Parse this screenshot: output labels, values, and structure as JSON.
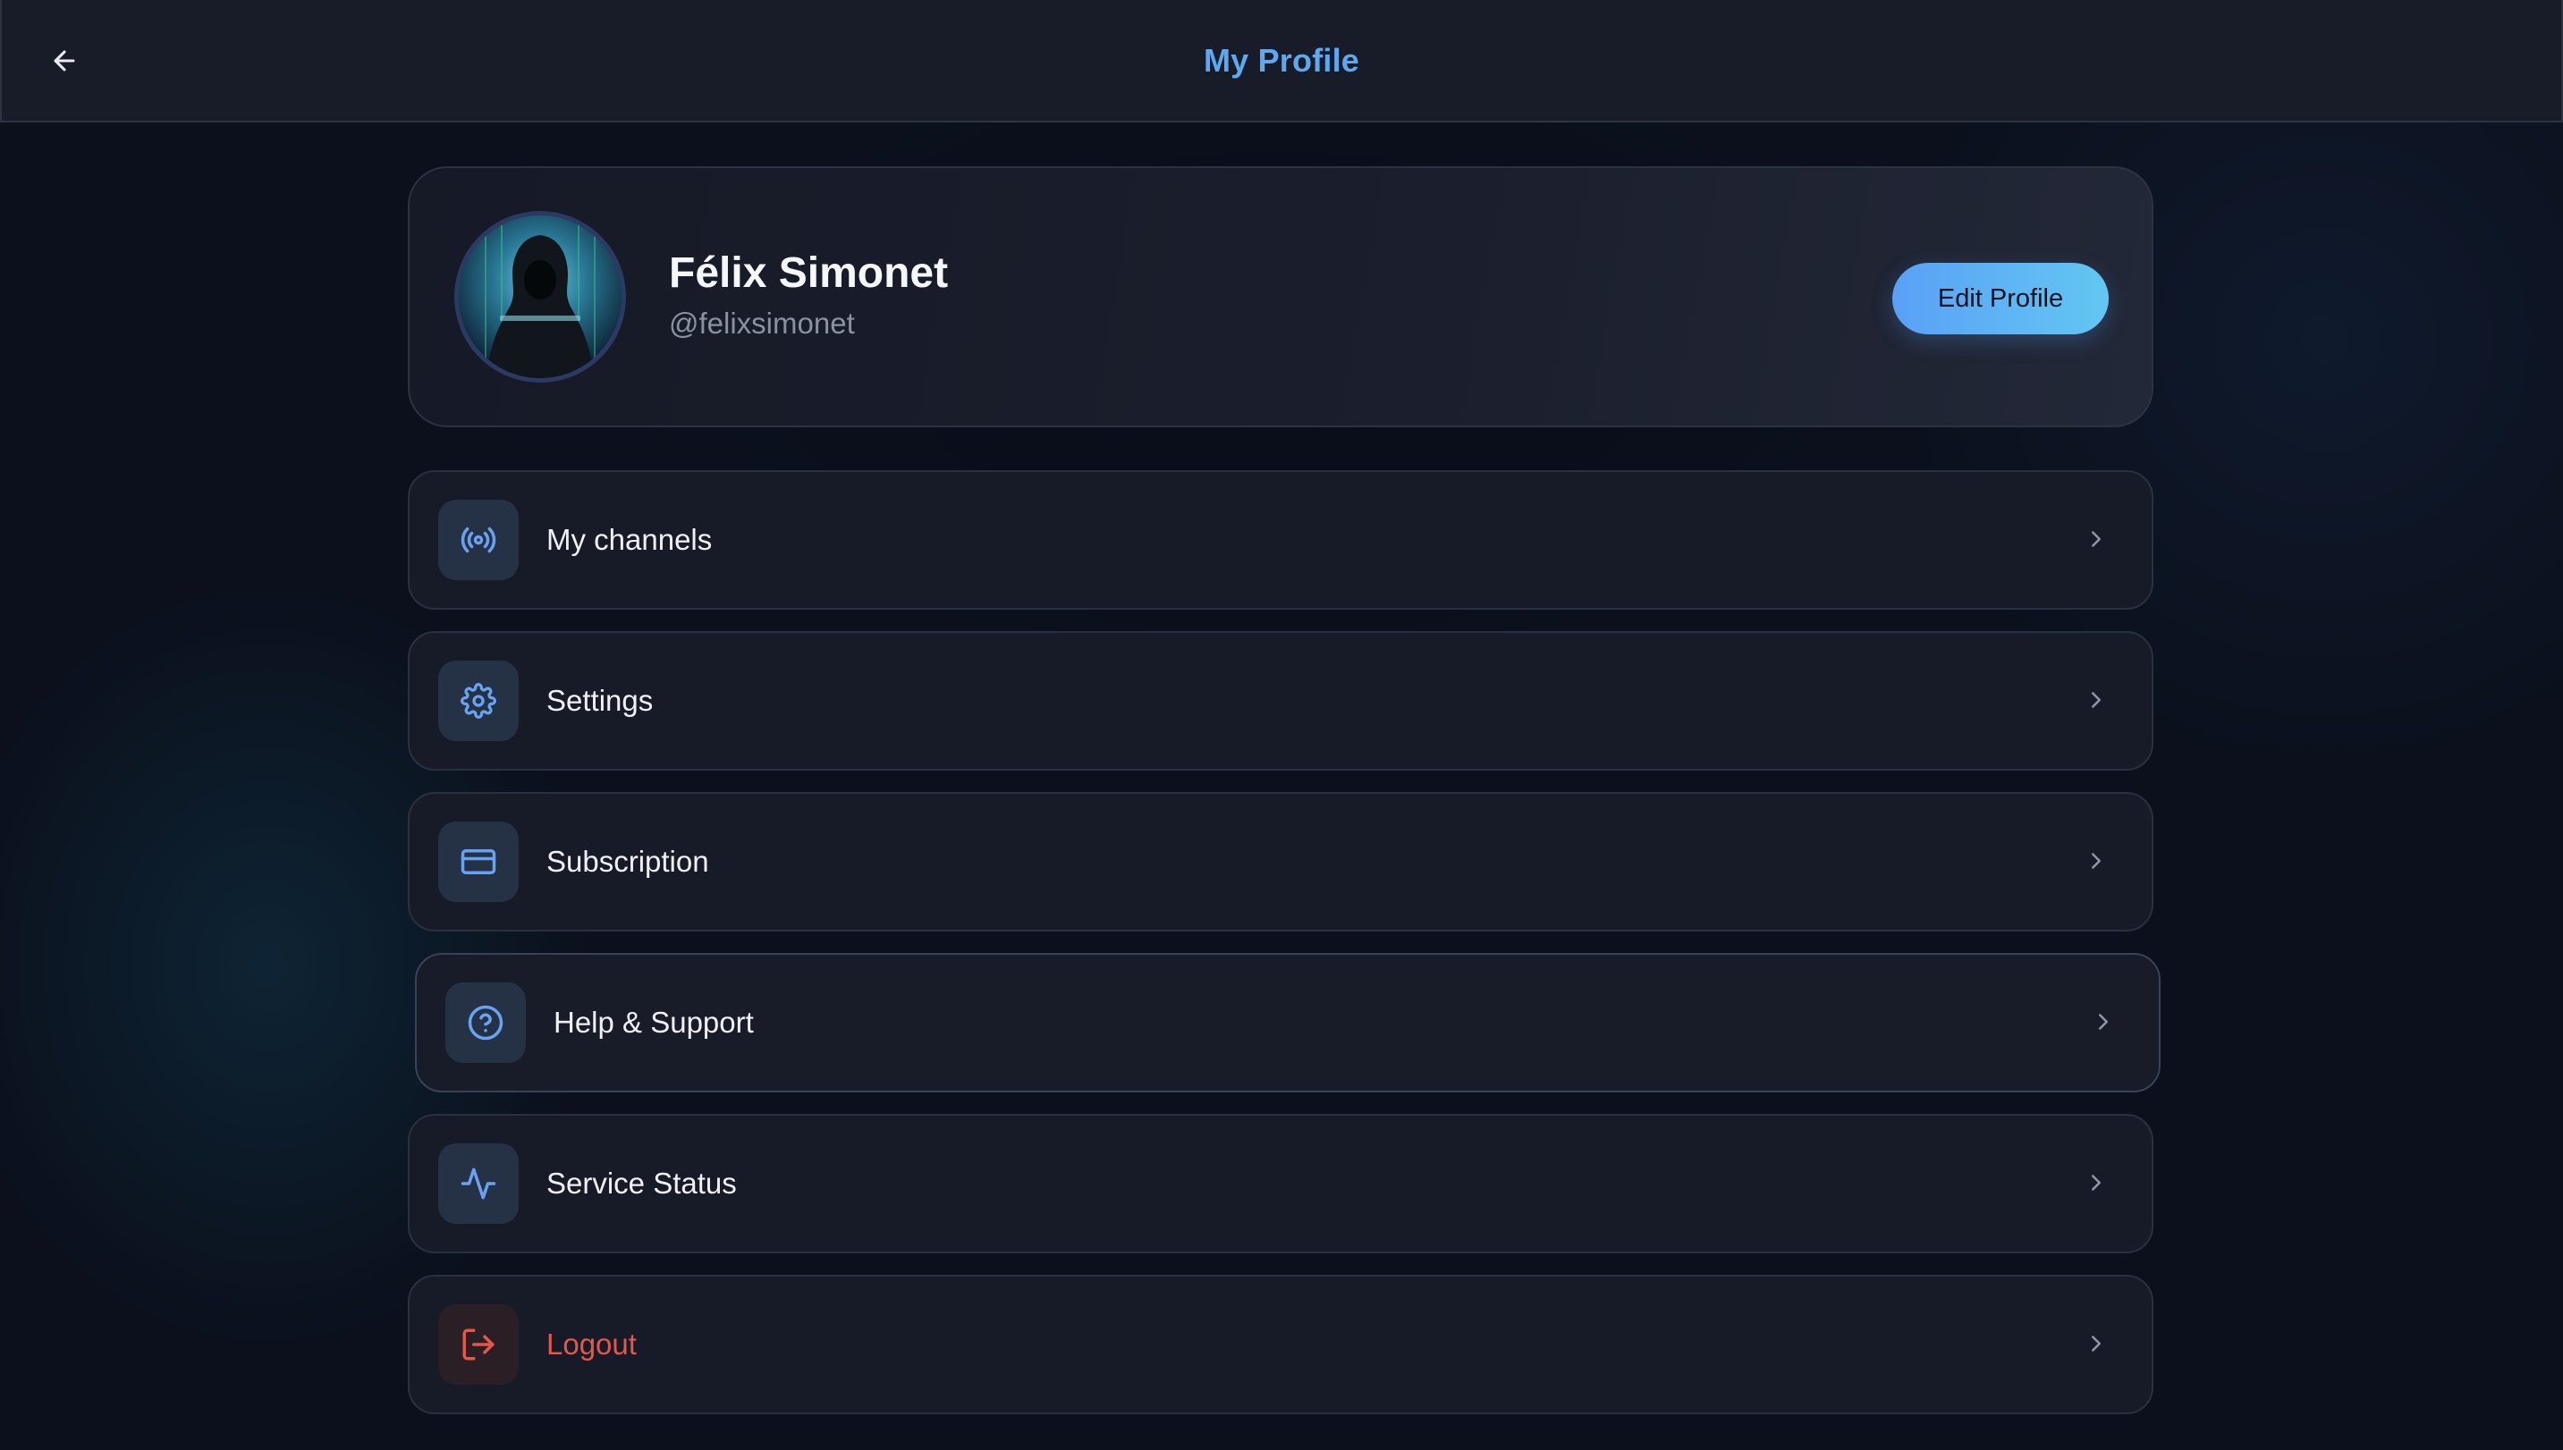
{
  "header": {
    "title": "My Profile",
    "back_icon": "arrow-left-icon"
  },
  "profile": {
    "name": "Félix Simonet",
    "handle": "@felixsimonet",
    "edit_label": "Edit Profile"
  },
  "menu": {
    "items": [
      {
        "label": "My channels",
        "icon": "broadcast-icon"
      },
      {
        "label": "Settings",
        "icon": "gear-icon"
      },
      {
        "label": "Subscription",
        "icon": "credit-card-icon"
      },
      {
        "label": "Help & Support",
        "icon": "help-circle-icon"
      },
      {
        "label": "Service Status",
        "icon": "activity-icon"
      },
      {
        "label": "Logout",
        "icon": "logout-icon"
      }
    ]
  },
  "colors": {
    "accent": "#5ea8f0",
    "icon_blue": "#6aa2f2",
    "danger": "#e5574a",
    "card_bg": "#171b27"
  }
}
